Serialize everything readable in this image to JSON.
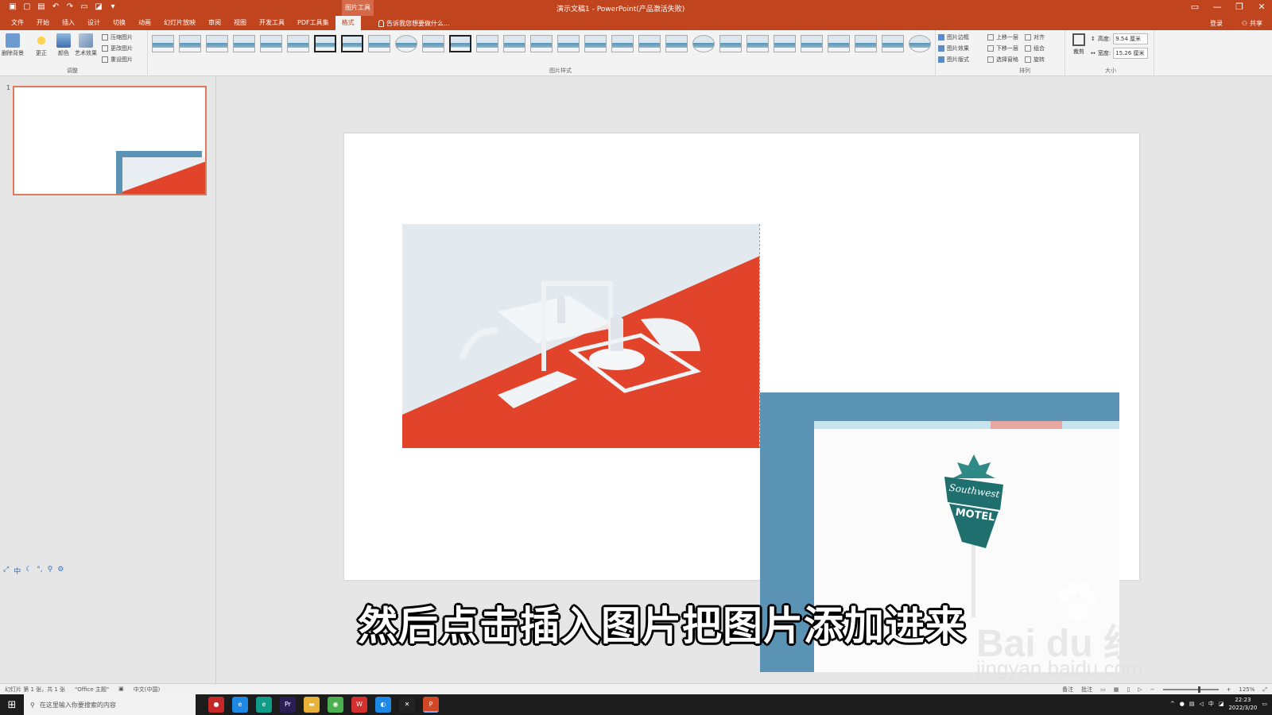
{
  "window": {
    "title": "演示文稿1 - PowerPoint(产品激活失败)",
    "context_tab_label": "图片工具"
  },
  "tabs": [
    {
      "label": "文件"
    },
    {
      "label": "开始"
    },
    {
      "label": "插入"
    },
    {
      "label": "设计"
    },
    {
      "label": "切换"
    },
    {
      "label": "动画"
    },
    {
      "label": "幻灯片放映"
    },
    {
      "label": "审阅"
    },
    {
      "label": "视图"
    },
    {
      "label": "开发工具"
    },
    {
      "label": "PDF工具集"
    },
    {
      "label": "格式"
    }
  ],
  "active_tab": "格式",
  "tell_me": "告诉我您想要做什么...",
  "signin": "登录",
  "share": "共享",
  "ribbon": {
    "adjust": {
      "remove_bg": "删除背景",
      "corrections": "更正",
      "color": "颜色",
      "artistic": "艺术效果",
      "compress": "压缩图片",
      "change": "更改图片",
      "reset": "重设图片",
      "label": "调整"
    },
    "styles": {
      "label": "图片样式"
    },
    "format": {
      "border": "图片边框",
      "effects": "图片效果",
      "layout": "图片版式"
    },
    "arrange": {
      "bring_forward": "上移一层",
      "send_backward": "下移一层",
      "selection_pane": "选择窗格",
      "align": "对齐",
      "group": "组合",
      "rotate": "旋转",
      "label": "排列"
    },
    "size": {
      "crop": "裁剪",
      "height_label": "高度:",
      "height_value": "9.54 厘米",
      "width_label": "宽度:",
      "width_value": "15.26 厘米",
      "label": "大小"
    }
  },
  "slide_pane": {
    "slide_number": "1"
  },
  "ime_bar": [
    "中"
  ],
  "subtitle": "然后点击插入图片把图片添加进来",
  "sign_text": {
    "line1": "Southwest",
    "line2": "MOTEL"
  },
  "watermark": {
    "main": "Bai du 经验",
    "url": "jingyan.baidu.com"
  },
  "status": {
    "slide_info": "幻灯片 第 1 张，共 1 张",
    "theme": "\"Office 主题\"",
    "language": "中文(中国)",
    "notes": "备注",
    "comments": "批注",
    "zoom": "125%"
  },
  "taskbar": {
    "search_placeholder": "在这里输入你要搜索的内容",
    "time": "22:23",
    "date": "2022/3/20",
    "ime": "中",
    "apps": [
      {
        "name": "record",
        "color": "#c62828",
        "glyph": "●"
      },
      {
        "name": "edge",
        "color": "#1e88e5",
        "glyph": "e"
      },
      {
        "name": "edge-dev",
        "color": "#0f9d8a",
        "glyph": "e"
      },
      {
        "name": "premiere",
        "color": "#2b1d55",
        "glyph": "Pr"
      },
      {
        "name": "explorer",
        "color": "#e8b13a",
        "glyph": "▬"
      },
      {
        "name": "chrome",
        "color": "#4caf50",
        "glyph": "◉"
      },
      {
        "name": "wps",
        "color": "#d32f2f",
        "glyph": "W"
      },
      {
        "name": "browser",
        "color": "#1e88e5",
        "glyph": "◐"
      },
      {
        "name": "capcut",
        "color": "#222222",
        "glyph": "✕"
      },
      {
        "name": "powerpoint",
        "color": "#d24726",
        "glyph": "P"
      }
    ]
  },
  "colors": {
    "accent": "#c0441e",
    "photo_red": "#e2432b",
    "photo_blue": "#5a93b3",
    "sign_teal": "#1e6f6e"
  }
}
